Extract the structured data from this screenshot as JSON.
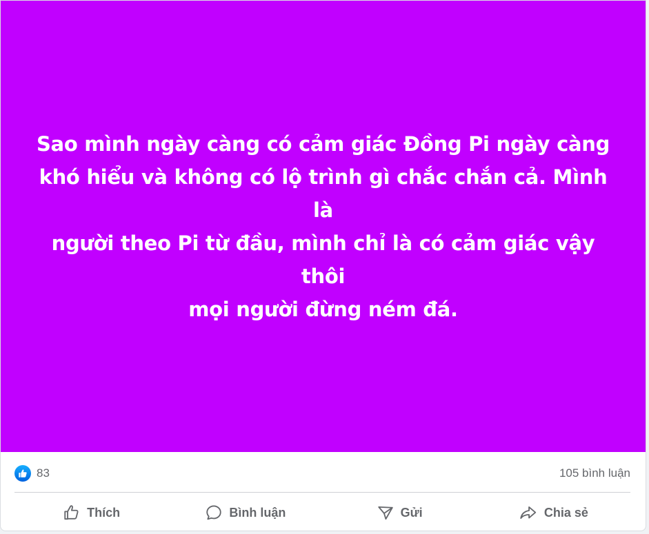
{
  "post": {
    "background_color": "#c100ff",
    "text_color": "#ffffff",
    "lines": [
      "Sao mình ngày càng có cảm giác Đồng Pi ngày càng",
      "khó hiểu và không có lộ trình gì chắc chắn cả. Mình là",
      "người theo Pi từ đầu, mình chỉ là có cảm giác vậy thôi",
      "mọi người đừng ném đá."
    ]
  },
  "stats": {
    "reaction_icon": "like-icon",
    "reaction_count": "83",
    "comment_count": "105 bình luận"
  },
  "actions": {
    "like": {
      "label": "Thích",
      "icon": "thumbs-up-icon"
    },
    "comment": {
      "label": "Bình luận",
      "icon": "speech-bubble-icon"
    },
    "send": {
      "label": "Gửi",
      "icon": "send-icon"
    },
    "share": {
      "label": "Chia sẻ",
      "icon": "share-arrow-icon"
    }
  },
  "colors": {
    "like_badge": "#1877f2",
    "muted_text": "#65676b",
    "divider": "#ced0d4"
  }
}
